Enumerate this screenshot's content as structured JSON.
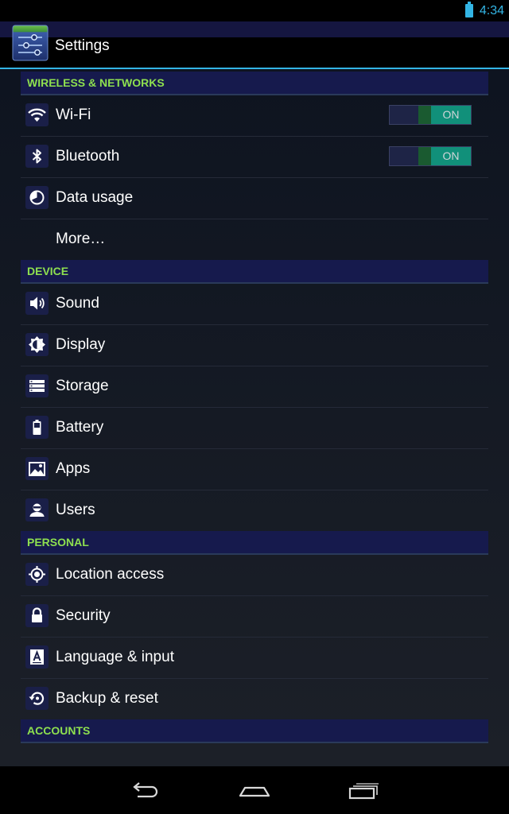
{
  "status_bar": {
    "time": "4:34",
    "battery_icon": "battery-full-icon",
    "accent_color": "#33b5e5"
  },
  "action_bar": {
    "title": "Settings",
    "app_icon": "settings-sliders-icon"
  },
  "sections": {
    "wireless": {
      "title": "WIRELESS & NETWORKS",
      "items": {
        "wifi": {
          "label": "Wi-Fi",
          "icon": "wifi-icon",
          "toggle": "ON"
        },
        "bluetooth": {
          "label": "Bluetooth",
          "icon": "bluetooth-icon",
          "toggle": "ON"
        },
        "data_usage": {
          "label": "Data usage",
          "icon": "data-usage-icon"
        },
        "more": {
          "label": "More…"
        }
      }
    },
    "device": {
      "title": "DEVICE",
      "items": {
        "sound": {
          "label": "Sound",
          "icon": "speaker-icon"
        },
        "display": {
          "label": "Display",
          "icon": "brightness-icon"
        },
        "storage": {
          "label": "Storage",
          "icon": "storage-icon"
        },
        "battery": {
          "label": "Battery",
          "icon": "battery-icon"
        },
        "apps": {
          "label": "Apps",
          "icon": "apps-icon"
        },
        "users": {
          "label": "Users",
          "icon": "user-icon"
        }
      }
    },
    "personal": {
      "title": "PERSONAL",
      "items": {
        "location": {
          "label": "Location access",
          "icon": "location-icon"
        },
        "security": {
          "label": "Security",
          "icon": "lock-icon"
        },
        "language": {
          "label": "Language & input",
          "icon": "keyboard-a-icon"
        },
        "backup": {
          "label": "Backup & reset",
          "icon": "backup-reset-icon"
        }
      }
    },
    "accounts": {
      "title": "ACCOUNTS"
    }
  },
  "colors": {
    "header_text": "#8ee04f",
    "header_bg": "#161a4d",
    "toggle_on": "#11907a"
  },
  "nav_bar": {
    "back": "back-icon",
    "home": "home-icon",
    "recents": "recents-icon"
  }
}
